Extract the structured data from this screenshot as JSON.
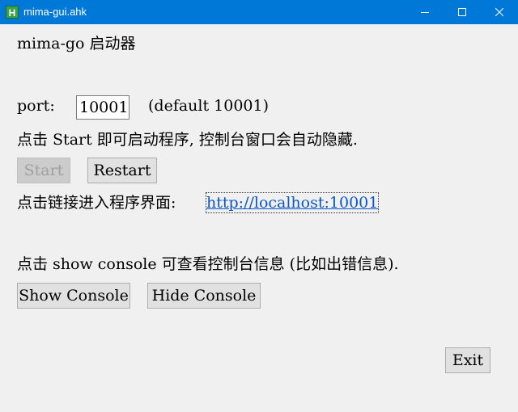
{
  "window": {
    "title": "mima-gui.ahk",
    "icon_letter": "H",
    "accent": "#0078d7",
    "controls": [
      "minimize-icon",
      "maximize-icon",
      "close-icon"
    ]
  },
  "main": {
    "heading": "mima-go 启动器",
    "port_label": "port:",
    "port_value": "10001",
    "port_default": "(default 10001)",
    "start_info": "点击 Start 即可启动程序, 控制台窗口会自动隐藏.",
    "start_label": "Start",
    "restart_label": "Restart",
    "link_label": "点击链接进入程序界面:",
    "link_url": "http://localhost:10001",
    "console_info": "点击 show console 可查看控制台信息 (比如出错信息).",
    "show_console_label": "Show Console",
    "hide_console_label": "Hide Console",
    "exit_label": "Exit"
  }
}
